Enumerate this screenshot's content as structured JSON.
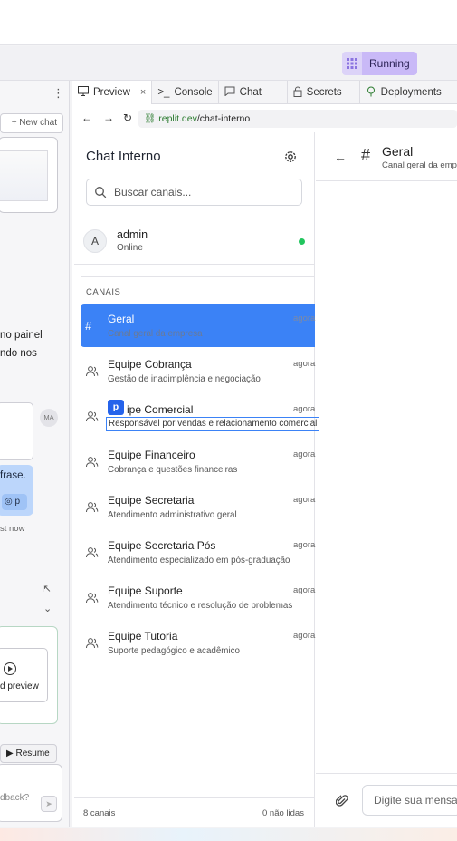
{
  "topbar": {
    "run_label": "Running"
  },
  "agent": {
    "new_chat": "+ New chat",
    "line1": "no painel",
    "line2": "ndo nos",
    "avatar_initials": "MA",
    "bubble_text": "frase.",
    "bubble_chip": "p",
    "timestamp": "st now",
    "preview_label": "d preview",
    "resume_label": "Resume",
    "feedback_placeholder": "dback?"
  },
  "tabs": [
    {
      "label": "Preview",
      "icon": "monitor-icon",
      "active": true,
      "closable": true
    },
    {
      "label": "Console",
      "icon": "terminal-icon"
    },
    {
      "label": "Chat",
      "icon": "chat-bubble-icon"
    },
    {
      "label": "Secrets",
      "icon": "lock-icon"
    },
    {
      "label": "Deployments",
      "icon": "deploy-icon"
    }
  ],
  "url": {
    "host": ".replit.dev",
    "path": "/chat-interno"
  },
  "sidebar": {
    "title": "Chat Interno",
    "search_placeholder": "Buscar canais...",
    "user": {
      "initial": "A",
      "name": "admin",
      "status": "Online"
    },
    "section_label": "CANAIS",
    "channels": [
      {
        "name": "Geral",
        "desc": "Canal geral da empresa",
        "time": "agora",
        "icon": "#",
        "active": true
      },
      {
        "name": "Equipe Cobrança",
        "desc": "Gestão de inadimplência e negociação",
        "time": "agora"
      },
      {
        "name": "ipe Comercial",
        "tag": "p",
        "desc": "Responsável por vendas e relacionamento comercial",
        "time": "agora",
        "selected": true
      },
      {
        "name": "Equipe Financeiro",
        "desc": "Cobrança e questões financeiras",
        "time": "agora"
      },
      {
        "name": "Equipe Secretaria",
        "desc": "Atendimento administrativo geral",
        "time": "agora"
      },
      {
        "name": "Equipe Secretaria Pós",
        "desc": "Atendimento especializado em pós-graduação",
        "time": "agora"
      },
      {
        "name": "Equipe Suporte",
        "desc": "Atendimento técnico e resolução de problemas",
        "time": "agora"
      },
      {
        "name": "Equipe Tutoria",
        "desc": "Suporte pedagógico e acadêmico",
        "time": "agora"
      }
    ],
    "footer": {
      "count": "8 canais",
      "unread": "0 não lidas"
    }
  },
  "chat": {
    "title": "Geral",
    "subtitle": "Canal geral da emp",
    "input_placeholder": "Digite sua mensag"
  }
}
